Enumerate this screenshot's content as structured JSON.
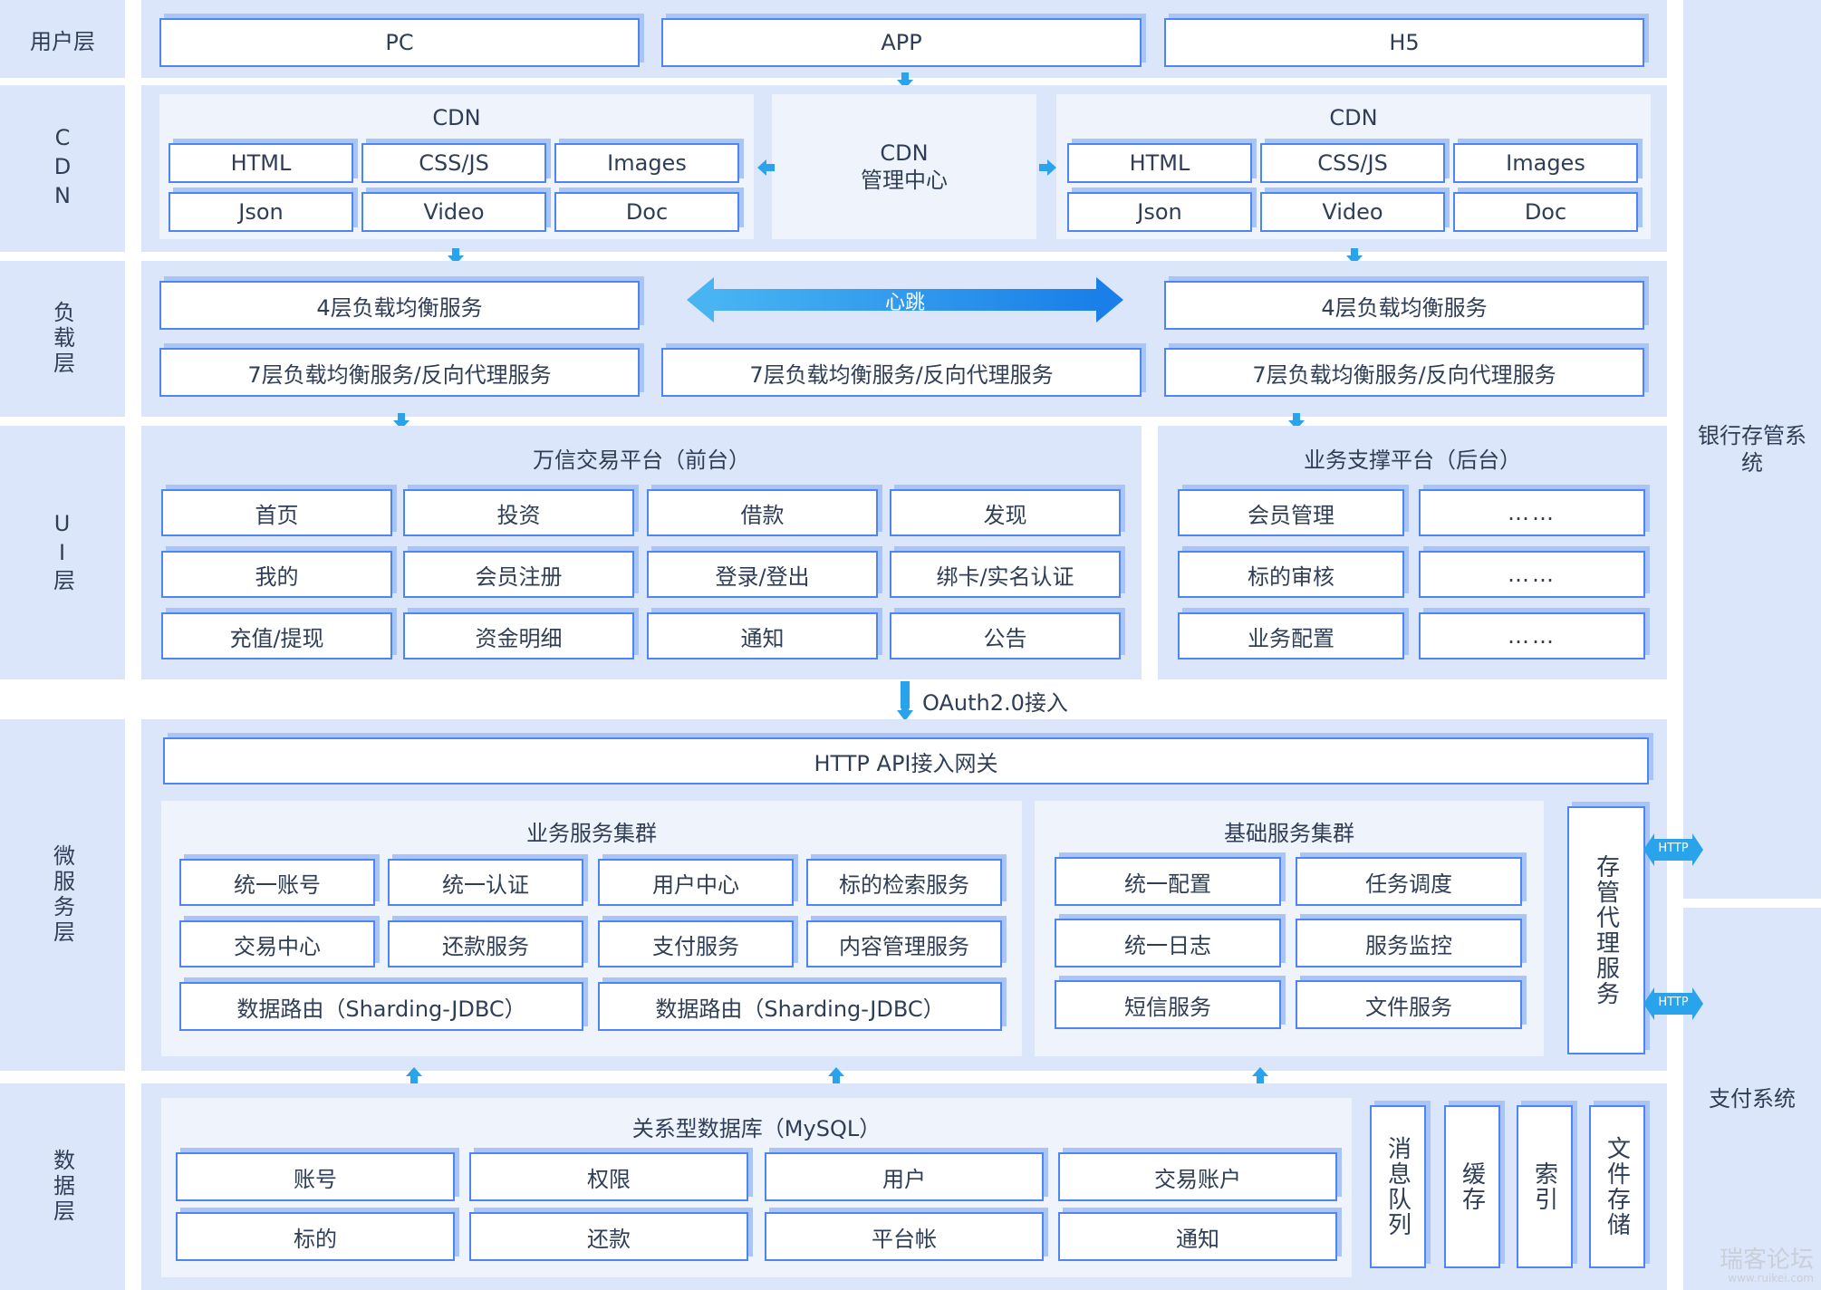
{
  "layers": {
    "user": "用户层",
    "cdn": "CDN",
    "lb": "负载层",
    "ui": "UI层",
    "micro": "微服务层",
    "data": "数据层"
  },
  "user_layer": {
    "items": [
      "PC",
      "APP",
      "H5"
    ]
  },
  "cdn_layer": {
    "left": {
      "title": "CDN",
      "items": [
        "HTML",
        "CSS/JS",
        "Images",
        "Json",
        "Video",
        "Doc"
      ]
    },
    "center": {
      "line1": "CDN",
      "line2": "管理中心"
    },
    "right": {
      "title": "CDN",
      "items": [
        "HTML",
        "CSS/JS",
        "Images",
        "Json",
        "Video",
        "Doc"
      ]
    }
  },
  "lb_layer": {
    "l4_left": "4层负载均衡服务",
    "l4_right": "4层负载均衡服务",
    "heartbeat": "心跳",
    "l7": [
      "7层负载均衡服务/反向代理服务",
      "7层负载均衡服务/反向代理服务",
      "7层负载均衡服务/反向代理服务"
    ]
  },
  "ui_layer": {
    "front": {
      "title": "万信交易平台（前台）",
      "items": [
        "首页",
        "投资",
        "借款",
        "发现",
        "我的",
        "会员注册",
        "登录/登出",
        "绑卡/实名认证",
        "充值/提现",
        "资金明细",
        "通知",
        "公告"
      ]
    },
    "back": {
      "title": "业务支撑平台（后台）",
      "items": [
        "会员管理",
        "……",
        "标的审核",
        "……",
        "业务配置",
        "……"
      ]
    }
  },
  "oauth_label": "OAuth2.0接入",
  "micro_layer": {
    "gateway": "HTTP API接入网关",
    "business": {
      "title": "业务服务集群",
      "items": [
        "统一账号",
        "统一认证",
        "用户中心",
        "标的检索服务",
        "交易中心",
        "还款服务",
        "支付服务",
        "内容管理服务"
      ],
      "routing": [
        "数据路由（Sharding-JDBC）",
        "数据路由（Sharding-JDBC）"
      ]
    },
    "basic": {
      "title": "基础服务集群",
      "items": [
        "统一配置",
        "任务调度",
        "统一日志",
        "服务监控",
        "短信服务",
        "文件服务"
      ]
    },
    "proxy": "存管代理服务",
    "http_labels": [
      "HTTP",
      "HTTP"
    ]
  },
  "data_layer": {
    "rdb": {
      "title": "关系型数据库（MySQL）",
      "items": [
        "账号",
        "权限",
        "用户",
        "交易账户",
        "标的",
        "还款",
        "平台帐",
        "通知"
      ]
    },
    "stores": [
      "消息队列",
      "缓存",
      "索引",
      "文件存储"
    ]
  },
  "external": {
    "bank": "银行存管系统",
    "payment": "支付系统"
  },
  "watermark": {
    "main": "瑞客论坛",
    "sub": "www.ruikei.com"
  }
}
